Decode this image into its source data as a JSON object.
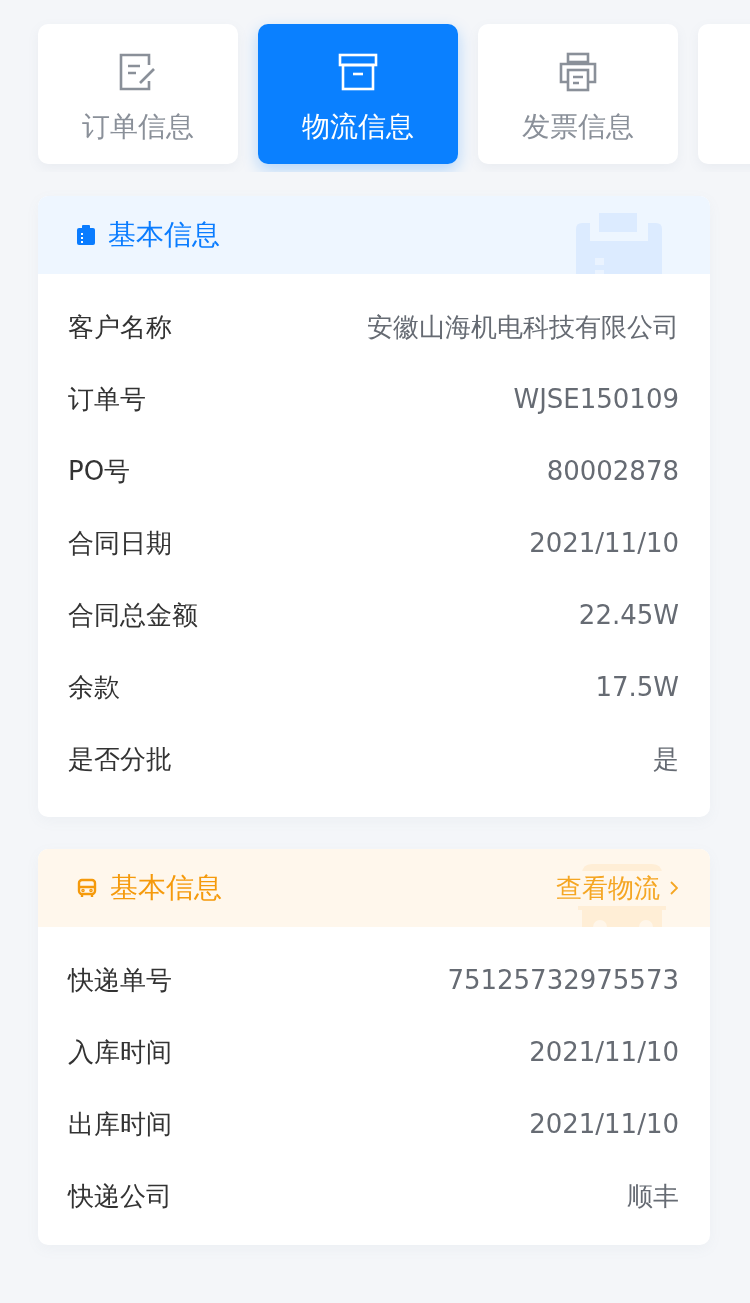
{
  "tabs": [
    {
      "label": "订单信息",
      "selected": false
    },
    {
      "label": "物流信息",
      "selected": true
    },
    {
      "label": "发票信息",
      "selected": false
    },
    {
      "selected": false
    }
  ],
  "sections": [
    {
      "kind": "basic",
      "title": "基本信息",
      "rows": [
        {
          "label": "客户名称",
          "value": "安徽山海机电科技有限公司"
        },
        {
          "label": "订单号",
          "value": "WJSE150109"
        },
        {
          "label": "PO号",
          "value": "80002878"
        },
        {
          "label": "合同日期",
          "value": "2021/11/10"
        },
        {
          "label": "合同总金额",
          "value": "22.45W"
        },
        {
          "label": "余款",
          "value": "17.5W"
        },
        {
          "label": "是否分批",
          "value": "是"
        }
      ]
    },
    {
      "kind": "shipping",
      "title": "基本信息",
      "link": "查看物流",
      "rows": [
        {
          "label": "快递单号",
          "value": "75125732975573"
        },
        {
          "label": "入库时间",
          "value": "2021/11/10"
        },
        {
          "label": "出库时间",
          "value": "2021/11/10"
        },
        {
          "label": "快递公司",
          "value": "顺丰"
        }
      ]
    }
  ]
}
